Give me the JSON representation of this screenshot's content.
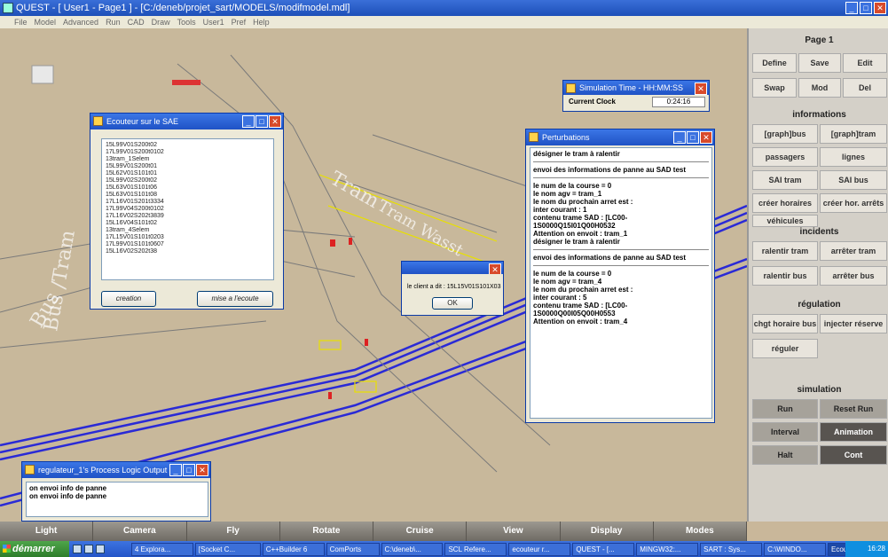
{
  "window": {
    "title": "QUEST - [ User1 - Page1 ] - [C:/deneb/projet_sart/MODELS/modifmodel.mdl]",
    "menu": [
      "File",
      "Model",
      "Advanced",
      "Run",
      "CAD",
      "Draw",
      "Tools",
      "User1",
      "Pref",
      "Help"
    ]
  },
  "scene": {
    "labels": [
      "Bus /Tram",
      "Bus",
      "Tram",
      "Tram Wasst"
    ]
  },
  "right_panel": {
    "page_title": "Page 1",
    "page_buttons": [
      "Define",
      "Save",
      "Edit",
      "Swap",
      "Mod",
      "Del"
    ],
    "informations_title": "informations",
    "info_buttons": [
      "[graph]bus",
      "[graph]tram",
      "passagers",
      "lignes",
      "SAI tram",
      "SAI bus",
      "créer horaires",
      "créer hor. arrêts",
      "véhicules"
    ],
    "incidents_title": "incidents",
    "incident_buttons": [
      "ralentir tram",
      "arrêter tram",
      "ralentir bus",
      "arrêter bus"
    ],
    "regulation_title": "régulation",
    "regulation_buttons": [
      "chgt horaire bus",
      "injecter réserve",
      "réguler"
    ],
    "simulation_title": "simulation",
    "simulation_buttons": [
      "Run",
      "Reset Run",
      "Interval",
      "Animation",
      "Halt",
      "Cont"
    ]
  },
  "bottom_bar": [
    "Light",
    "Camera",
    "Fly",
    "Rotate",
    "Cruise",
    "View",
    "Display",
    "Modes"
  ],
  "ecouteur": {
    "title": "Ecouteur sur le SAE",
    "items": [
      "15L99V01S200t02",
      "17L99V01S200t0102",
      "13tram_1Selem",
      "15L99V01S200t01",
      "15L62V01S101t01",
      "15L99V02S200t02",
      "15L63V01S101t06",
      "15L63V01S101t08",
      "17L16V01S201t3334",
      "17L99V04S200t0102",
      "17L16V02S202t3839",
      "15L16V04S101t02",
      "13tram_4Selem",
      "17L15V01S101t0203",
      "17L99V01S101t0607",
      "15L16V02S202t38"
    ],
    "btn_creation": "creation",
    "btn_listen": "mise a l'ecoute"
  },
  "simtime": {
    "title": "Simulation Time - HH:MM:SS",
    "label": "Current Clock",
    "value": "0:24:16"
  },
  "perturbations": {
    "title": "Perturbations",
    "lines": [
      "désigner le tram à ralentir",
      "---",
      "envoi des informations de panne au SAD test",
      "---",
      "le num de la course = 0",
      "le nom agv = tram_1",
      "le nom du prochain arret est :",
      "inter courant : 1",
      "contenu trame SAD : [LC00-1S0000Q15I01Q00H0532",
      "Attention on envoit : tram_1",
      "désigner le tram à ralentir",
      "---",
      "envoi des informations de panne au SAD test",
      "---",
      "le num de la course = 0",
      "le nom agv = tram_4",
      "le nom du prochain arret est :",
      "inter courant : 5",
      "contenu trame SAD : [LC00-1S0000Q00I05Q00H0553",
      "Attention on envoit : tram_4"
    ]
  },
  "dialog": {
    "message": "le client a dit : 15L15V01S101X03",
    "ok": "OK"
  },
  "logic_output": {
    "title": "regulateur_1's Process Logic Output",
    "lines": [
      "on envoi info de panne",
      "on envoi info de panne"
    ]
  },
  "taskbar": {
    "start": "démarrer",
    "items": [
      "4 Explora...",
      "[Socket C...",
      "C++Builder 6",
      "ComPorts",
      "C:\\deneb\\...",
      "SCL Refere...",
      "ecouteur r...",
      "QUEST - [...",
      "MINGW32:...",
      "SART : Sys...",
      "C:\\WINDO...",
      "Ecouteur s..."
    ],
    "clock": "16:28"
  },
  "colors": {
    "track": "#2a2ad6",
    "panel": "#d4d0c8",
    "scene": "#c8b89b"
  }
}
